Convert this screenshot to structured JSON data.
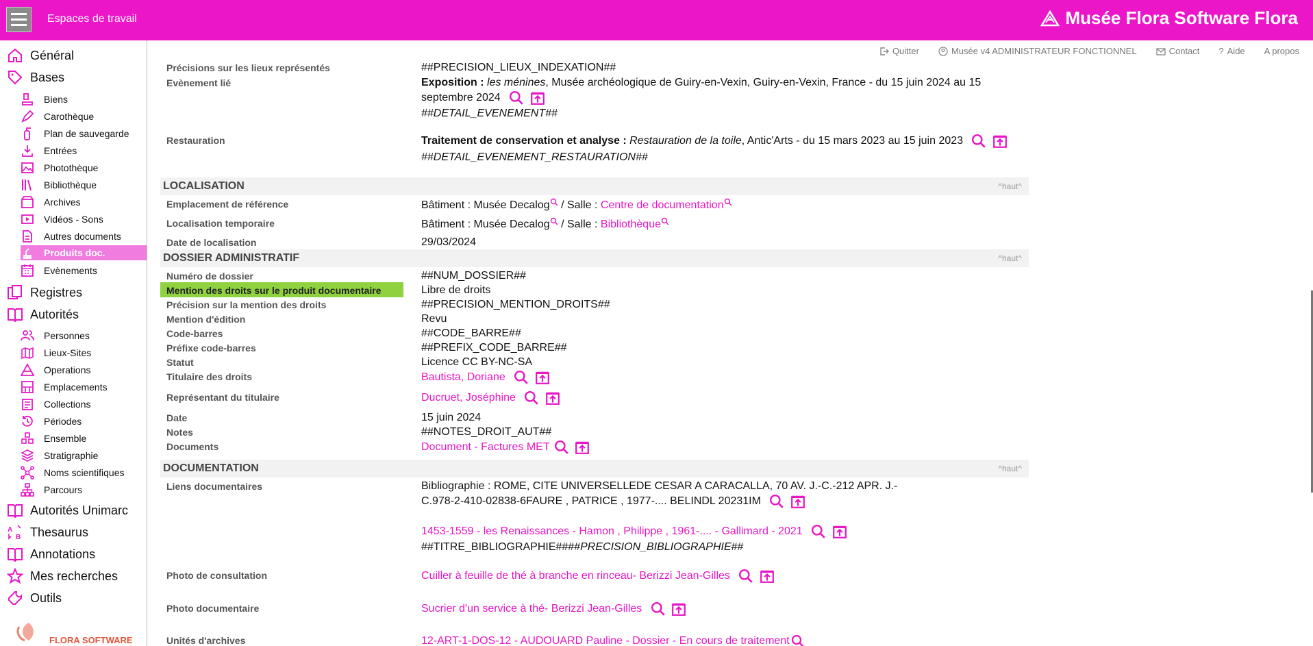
{
  "topbar": {
    "workspace_title": "Espaces de travail",
    "brand": "Musée Flora Software Flora"
  },
  "toplinks": {
    "quit": "Quitter",
    "user": "Musée v4 ADMINISTRATEUR FONCTIONNEL",
    "contact": "Contact",
    "help": "Aide",
    "about": "A propos"
  },
  "sidebar": {
    "general": "Général",
    "bases": "Bases",
    "biens": "Biens",
    "carotheque": "Carothèque",
    "plan_sauvegarde": "Plan de sauvegarde",
    "entrees": "Entrées",
    "phototheque": "Photothèque",
    "bibliotheque": "Bibliothèque",
    "archives": "Archives",
    "videos": "Vidéos - Sons",
    "autres_docs": "Autres documents",
    "produits_doc": "Produits doc.",
    "evenements": "Evènements",
    "registres": "Registres",
    "autorites": "Autorités",
    "personnes": "Personnes",
    "lieux_sites": "Lieux-Sites",
    "operations": "Operations",
    "emplacements": "Emplacements",
    "collections": "Collections",
    "periodes": "Périodes",
    "ensemble": "Ensemble",
    "stratigraphie": "Stratigraphie",
    "noms_scientifiques": "Noms scientifiques",
    "parcours": "Parcours",
    "autorites_unimarc": "Autorités Unimarc",
    "thesaurus": "Thesaurus",
    "annotations": "Annotations",
    "mes_recherches": "Mes recherches",
    "outils": "Outils",
    "logo_text": "FLORA SOFTWARE"
  },
  "colors": {
    "accent": "#ec16c9",
    "link": "#e716c6",
    "active": "#f07ce0",
    "highlight": "#8fd13f"
  },
  "rows": {
    "precisions_lieux": {
      "label": "Précisions sur les lieux représentés",
      "value": "##PRECISION_LIEUX_INDEXATION##"
    },
    "evenement_lie": {
      "label": "Evènement lié",
      "prefix": "Exposition :",
      "title": "les ménines",
      "text": ",  Musée archéologique de Guiry-en-Vexin, Guiry-en-Vexin, France - du 15 juin 2024 au 15 septembre 2024",
      "detail": "##DETAIL_EVENEMENT##"
    },
    "restauration": {
      "label": "Restauration",
      "prefix": "Traitement de conservation et analyse :",
      "title": "Restauration de la toile",
      "text": ",  Antic'Arts - du 15 mars 2023 au 15 juin 2023",
      "detail": "##DETAIL_EVENEMENT_RESTAURATION##"
    }
  },
  "localisation": {
    "title": "LOCALISATION",
    "haut": "^haut^",
    "ref_label": "Emplacement de référence",
    "ref_bat": "Bâtiment : Musée Decalog",
    "ref_salle_label": "/  Salle :",
    "ref_salle": "Centre de documentation",
    "temp_label": "Localisation temporaire",
    "temp_bat": "Bâtiment : Musée Decalog",
    "temp_salle_label": "/  Salle :",
    "temp_salle": "Bibliothèque",
    "date_label": "Date de localisation",
    "date": "29/03/2024"
  },
  "dossier": {
    "title": "DOSSIER ADMINISTRATIF",
    "haut": "^haut^",
    "numero_label": "Numéro de dossier",
    "numero": "##NUM_DOSSIER##",
    "mention_label": "Mention des droits sur le produit documentaire",
    "mention": "Libre de droits",
    "precision_label": "Précision sur la mention des droits",
    "precision": "##PRECISION_MENTION_DROITS##",
    "edition_label": "Mention d'édition",
    "edition": "Revu",
    "codebarre_label": "Code-barres",
    "codebarre": "##CODE_BARRE##",
    "prefixe_label": "Préfixe code-barres",
    "prefixe": "##PREFIX_CODE_BARRE##",
    "statut_label": "Statut",
    "statut": "Licence CC BY-NC-SA",
    "titulaire_label": "Titulaire des droits",
    "titulaire": "Bautista, Doriane",
    "representant_label": "Représentant du titulaire",
    "representant": "Ducruet, Joséphine",
    "date_label": "Date",
    "date": "15 juin 2024",
    "notes_label": "Notes",
    "notes": "##NOTES_DROIT_AUT##",
    "documents_label": "Documents",
    "documents": "Document - Factures MET"
  },
  "documentation": {
    "title": "DOCUMENTATION",
    "haut": "^haut^",
    "liens_label": "Liens documentaires",
    "biblio1_line1": "Bibliographie : ROME, CITE UNIVERSELLEDE CESAR A CARACALLA, 70 AV. J.-C.-212 APR. J.-",
    "biblio1_line2": "C.978-2-410-02838-6FAURE , PATRICE , 1977-.... BELINDL 20231IM",
    "biblio2": "1453-1559 - les Renaissances - Hamon , Philippe , 1961-.... - Gallimard - 2021",
    "biblio2_detail_a": "##TITRE_BIBLIOGRAPHIE####",
    "biblio2_detail_b": "PRECISION_BIBLIOGRAPHIE",
    "biblio2_detail_c": "##",
    "photo_consult_label": "Photo de consultation",
    "photo_consult": "Cuiller à feuille de thé à branche en rinceau- Berizzi Jean-Gilles",
    "photo_doc_label": "Photo documentaire",
    "photo_doc": "Sucrier d'un service à thé- Berizzi Jean-Gilles",
    "unites_label": "Unités d'archives",
    "unites": "12-ART-1-DOS-12 - AUDOUARD Pauline - Dossier - En cours de traitement"
  }
}
